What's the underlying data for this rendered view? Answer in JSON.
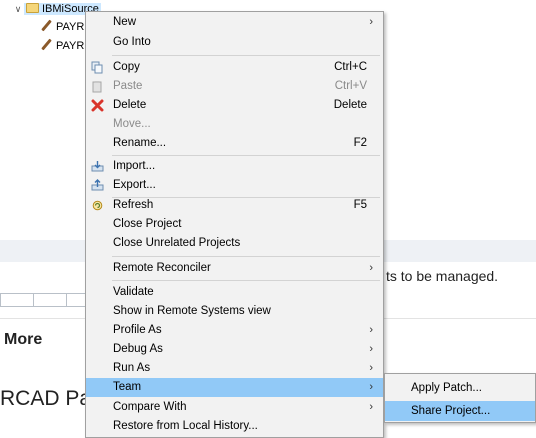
{
  "tree": {
    "project": "IBMiSource",
    "children": [
      "PAYR",
      "PAYR"
    ]
  },
  "background": {
    "managed_text": "ts to be managed.",
    "more_heading": "More",
    "rcad_text": "RCAD Pa"
  },
  "context_menu": {
    "new": "New",
    "go_into": "Go Into",
    "copy": "Copy",
    "copy_sc": "Ctrl+C",
    "paste": "Paste",
    "paste_sc": "Ctrl+V",
    "delete": "Delete",
    "delete_sc": "Delete",
    "move": "Move...",
    "rename": "Rename...",
    "rename_sc": "F2",
    "import": "Import...",
    "export": "Export...",
    "refresh": "Refresh",
    "refresh_sc": "F5",
    "close_project": "Close Project",
    "close_unrelated": "Close Unrelated Projects",
    "remote_reconciler": "Remote Reconciler",
    "validate": "Validate",
    "show_remote": "Show in Remote Systems view",
    "profile_as": "Profile As",
    "debug_as": "Debug As",
    "run_as": "Run As",
    "team": "Team",
    "compare_with": "Compare With",
    "restore_history": "Restore from Local History..."
  },
  "team_submenu": {
    "apply_patch": "Apply Patch...",
    "share_project": "Share Project..."
  },
  "colors": {
    "highlight": "#91c9f7",
    "menu_bg": "#f2f2f2",
    "delete_icon": "#d9342b"
  }
}
